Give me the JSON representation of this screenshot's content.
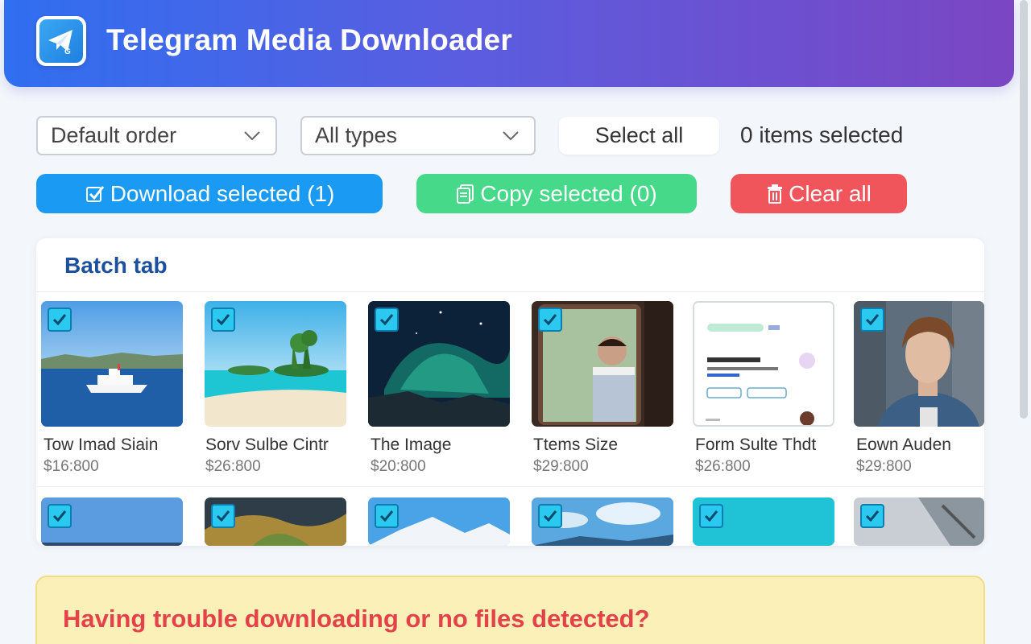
{
  "app": {
    "title": "Telegram Media Downloader",
    "logo_icon": "telegram-paper-plane-icon"
  },
  "filters": {
    "order_selected": "Default order",
    "type_selected": "All types",
    "select_all_label": "Select all",
    "items_selected_text": "0 items selected"
  },
  "actions": {
    "download_label": "Download selected (1)",
    "copy_label": "Copy selected (0)",
    "clear_label": "Clear all"
  },
  "colors": {
    "download": "#1a9af3",
    "copy": "#47d98a",
    "clear": "#f0555c",
    "header_start": "#2f6ff0",
    "header_end": "#7b46c3"
  },
  "batch": {
    "title": "Batch tab",
    "row1": [
      {
        "name": "Tow Imad Siain",
        "price": "$16:800",
        "checked": true
      },
      {
        "name": "Sorv Sulbe Cintr",
        "price": "$26:800",
        "checked": true
      },
      {
        "name": "The Image",
        "price": "$20:800",
        "checked": true
      },
      {
        "name": "Ttems Size",
        "price": "$29:800",
        "checked": true
      },
      {
        "name": "Form Sulte Thdt",
        "price": "$26:800",
        "checked": false
      },
      {
        "name": "Eown Auden",
        "price": "$29:800",
        "checked": true
      }
    ],
    "row2_checked": [
      true,
      true,
      true,
      true,
      true,
      true
    ]
  },
  "notice": {
    "text": "Having trouble downloading or no files detected?"
  }
}
